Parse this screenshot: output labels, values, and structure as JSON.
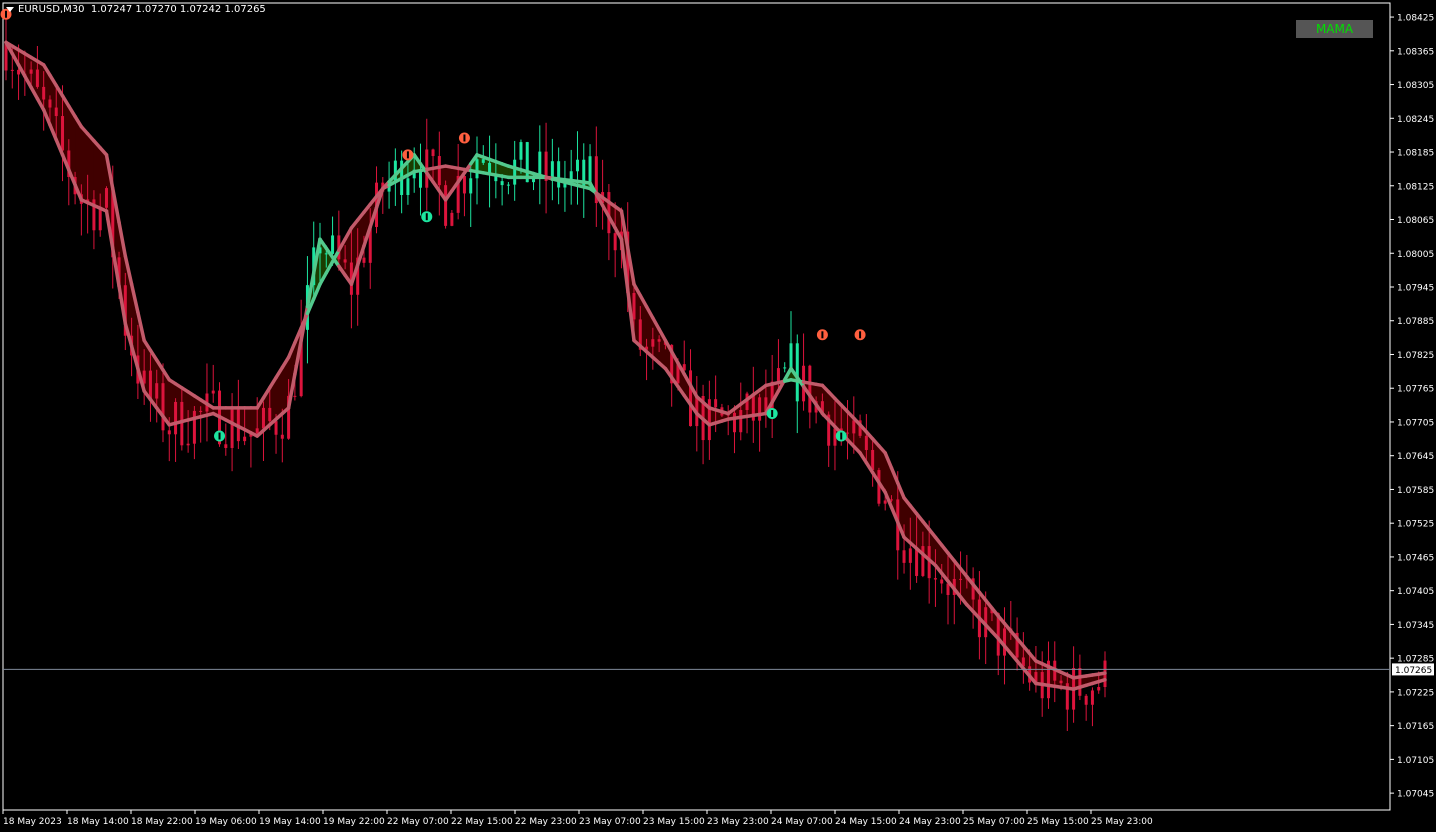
{
  "header": {
    "symbol": "EURUSD,M30",
    "ohlc": "1.07247 1.07270 1.07242 1.07265"
  },
  "indicator_button": {
    "label": "MAMA"
  },
  "price_label": "1.07265",
  "colors": {
    "bull_candle": "#1de5a0",
    "bear_candle": "#dc143c",
    "mama_bear_line": "#c25a6a",
    "mama_bull_line": "#52c98d",
    "bear_fill": "#400000",
    "bull_fill": "#1a3d00",
    "arrow_down": "#ff5f3f",
    "arrow_up": "#1de5a0",
    "grid_axis": "#ffffff"
  },
  "chart_data": {
    "type": "line",
    "title": "",
    "xlabel": "",
    "ylabel": "",
    "ylim": [
      1.07015,
      1.0845
    ],
    "y_ticks": [
      "1.08425",
      "1.08365",
      "1.08305",
      "1.08245",
      "1.08185",
      "1.08125",
      "1.08065",
      "1.08005",
      "1.07945",
      "1.07885",
      "1.07825",
      "1.07765",
      "1.07705",
      "1.07645",
      "1.07585",
      "1.07525",
      "1.07465",
      "1.07405",
      "1.07345",
      "1.07285",
      "1.07225",
      "1.07165",
      "1.07105",
      "1.07045"
    ],
    "x_ticks": [
      "18 May 2023",
      "18 May 14:00",
      "18 May 22:00",
      "19 May 06:00",
      "19 May 14:00",
      "19 May 22:00",
      "22 May 07:00",
      "22 May 15:00",
      "22 May 23:00",
      "23 May 07:00",
      "23 May 15:00",
      "23 May 23:00",
      "24 May 07:00",
      "24 May 15:00",
      "24 May 23:00",
      "25 May 07:00",
      "25 May 15:00",
      "25 May 23:00"
    ],
    "current_price": 1.07265,
    "bars": 176,
    "series": [
      {
        "x": [
          0,
          6,
          12,
          16,
          19,
          22,
          26,
          33,
          40,
          45,
          50,
          55,
          60,
          65,
          70,
          75,
          80,
          86,
          93,
          98,
          100,
          105,
          110,
          112,
          115,
          121,
          125,
          130,
          136,
          140,
          143,
          148,
          153,
          158,
          164,
          170,
          176
        ],
        "values": [
          1.0838,
          1.0826,
          1.081,
          1.0808,
          1.0788,
          1.0776,
          1.077,
          1.0772,
          1.0768,
          1.0773,
          1.0803,
          1.0795,
          1.0812,
          1.0818,
          1.081,
          1.0818,
          1.0816,
          1.0814,
          1.0813,
          1.0803,
          1.0785,
          1.078,
          1.0772,
          1.077,
          1.0771,
          1.0772,
          1.078,
          1.0772,
          1.0765,
          1.0758,
          1.075,
          1.0745,
          1.0738,
          1.0732,
          1.0724,
          1.0723,
          1.0725
        ]
      },
      {
        "x": [
          0,
          6,
          12,
          16,
          19,
          22,
          26,
          33,
          40,
          45,
          50,
          55,
          60,
          65,
          70,
          75,
          80,
          86,
          93,
          98,
          100,
          105,
          110,
          112,
          115,
          121,
          125,
          130,
          136,
          140,
          143,
          148,
          153,
          158,
          164,
          170,
          176
        ],
        "values": [
          1.0838,
          1.0834,
          1.0823,
          1.0818,
          1.08,
          1.0785,
          1.0778,
          1.0773,
          1.0773,
          1.0782,
          1.0795,
          1.0805,
          1.0812,
          1.0815,
          1.0816,
          1.0815,
          1.0814,
          1.0814,
          1.0812,
          1.0808,
          1.0795,
          1.0785,
          1.0775,
          1.0773,
          1.0772,
          1.0777,
          1.0778,
          1.0777,
          1.077,
          1.0765,
          1.0757,
          1.075,
          1.0743,
          1.0736,
          1.0728,
          1.0725,
          1.0726
        ]
      }
    ],
    "signals": [
      {
        "bar": 0,
        "dir": "down",
        "price": 1.0843
      },
      {
        "bar": 34,
        "dir": "up",
        "price": 1.0768
      },
      {
        "bar": 64,
        "dir": "down",
        "price": 1.0818
      },
      {
        "bar": 67,
        "dir": "up",
        "price": 1.0807
      },
      {
        "bar": 73,
        "dir": "down",
        "price": 1.0821
      },
      {
        "bar": 122,
        "dir": "up",
        "price": 1.0772
      },
      {
        "bar": 130,
        "dir": "down",
        "price": 1.0786
      },
      {
        "bar": 133,
        "dir": "up",
        "price": 1.0768
      },
      {
        "bar": 136,
        "dir": "down",
        "price": 1.0786
      }
    ]
  }
}
